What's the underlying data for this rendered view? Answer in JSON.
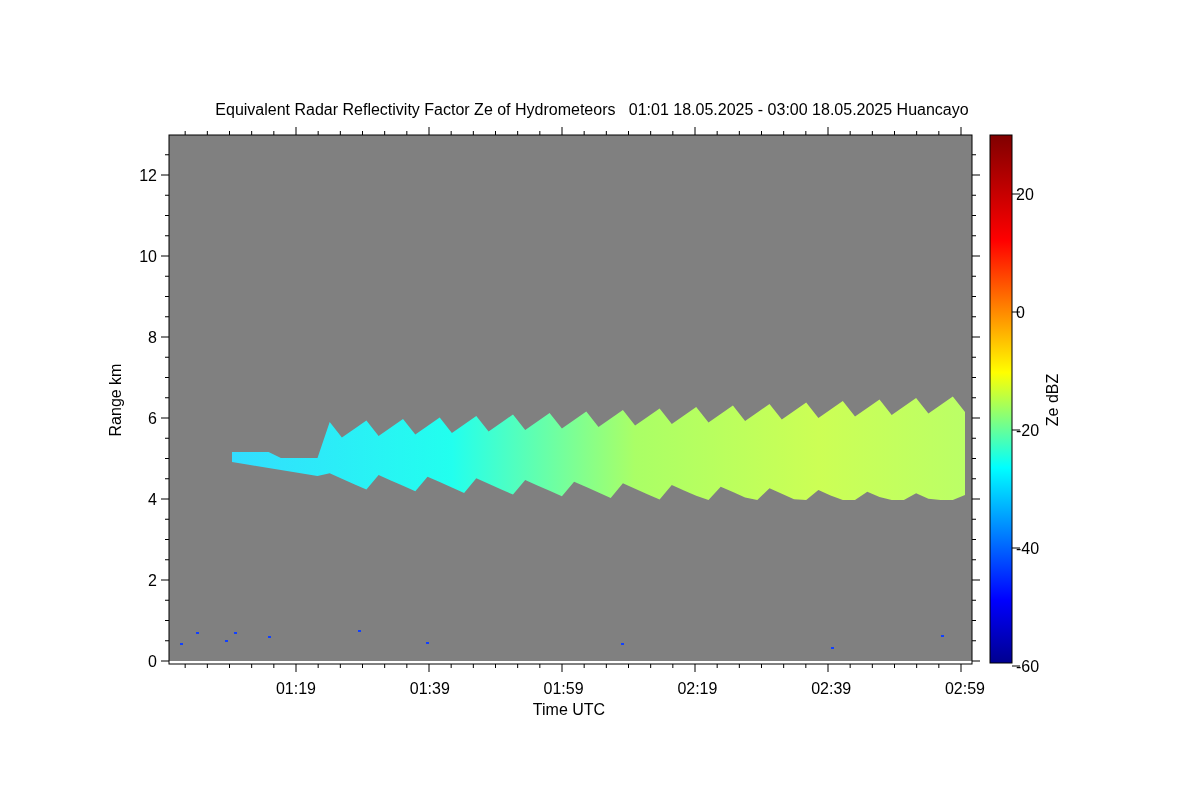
{
  "title": "Equivalent Radar Reflectivity Factor Ze of Hydrometeors   01:01 18.05.2025 - 03:00 18.05.2025 Huancayo",
  "y_axis": {
    "label": "Range km",
    "ticks": [
      "12",
      "10",
      "8",
      "6",
      "4",
      "2",
      "0"
    ]
  },
  "x_axis": {
    "label": "Time UTC",
    "ticks": [
      "01:19",
      "01:39",
      "01:59",
      "02:19",
      "02:39",
      "02:59"
    ]
  },
  "colorbar": {
    "label": "Ze dBZ",
    "ticks": [
      "20",
      "0",
      "-20",
      "-40",
      "-60"
    ]
  }
}
